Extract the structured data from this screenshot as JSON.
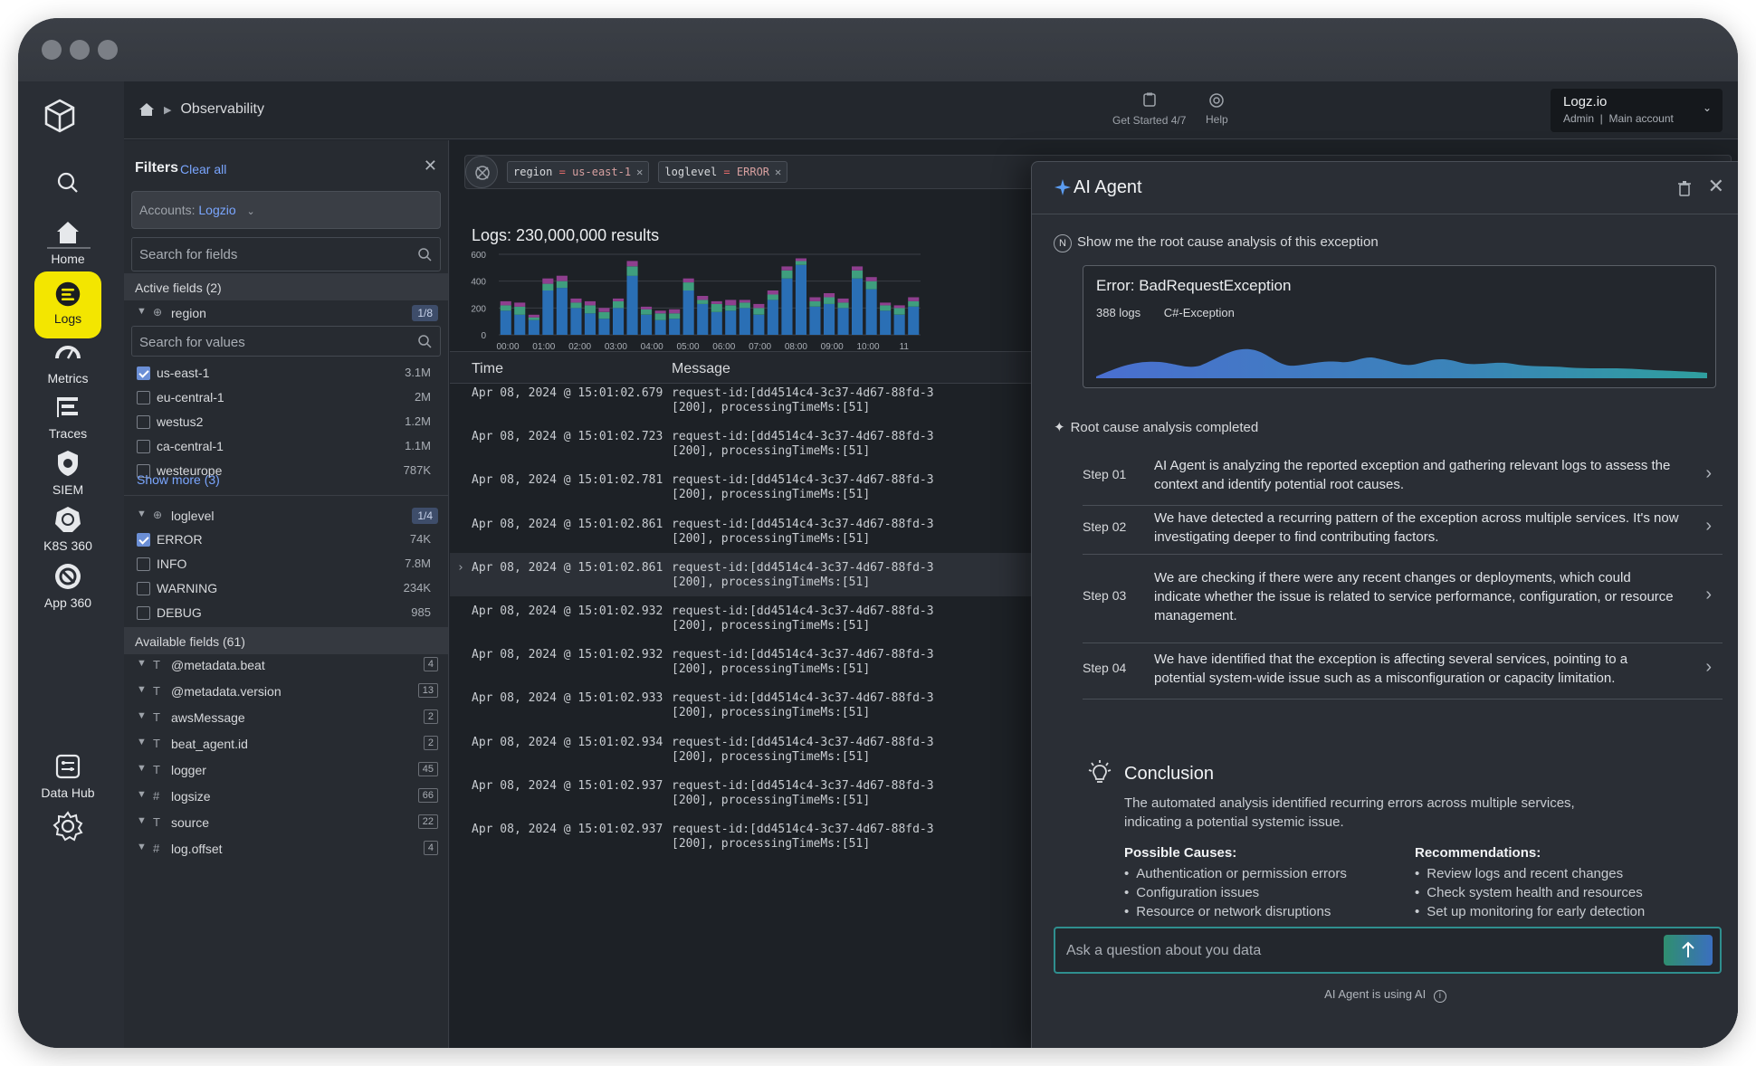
{
  "window": {
    "controls": [
      "close",
      "minimize",
      "maximize"
    ]
  },
  "rail": {
    "items": [
      {
        "label": "",
        "icon": "search-icon"
      },
      {
        "label": "Home",
        "icon": "home-icon"
      },
      {
        "label": "Logs",
        "icon": "logs-icon",
        "active": true
      },
      {
        "label": "Metrics",
        "icon": "gauge-icon"
      },
      {
        "label": "Traces",
        "icon": "traces-icon"
      },
      {
        "label": "SIEM",
        "icon": "shield-icon"
      },
      {
        "label": "K8S 360",
        "icon": "kubernetes-icon"
      },
      {
        "label": "App 360",
        "icon": "app-icon"
      },
      {
        "label": "Data Hub",
        "icon": "data-hub-icon"
      }
    ],
    "accent_color": "#f3e600"
  },
  "header": {
    "breadcrumb": "Observability",
    "get_started": "Get Started 4/7",
    "help": "Help",
    "account_name": "Logz.io",
    "account_role": "Admin",
    "account_sub": "Main account"
  },
  "filters": {
    "title": "Filters",
    "clear_all": "Clear all",
    "accounts_label": "Accounts:",
    "accounts_value": "Logzio",
    "search_fields_placeholder": "Search for fields",
    "active_fields": "Active fields (2)",
    "region": {
      "label": "region",
      "badge": "1/8",
      "search_placeholder": "Search for values",
      "values": [
        {
          "label": "us-east-1",
          "count": "3.1M",
          "checked": true
        },
        {
          "label": "eu-central-1",
          "count": "2M",
          "checked": false
        },
        {
          "label": "westus2",
          "count": "1.2M",
          "checked": false
        },
        {
          "label": "ca-central-1",
          "count": "1.1M",
          "checked": false
        },
        {
          "label": "westeurope",
          "count": "787K",
          "checked": false
        }
      ],
      "show_more": "Show more (3)"
    },
    "loglevel": {
      "label": "loglevel",
      "badge": "1/4",
      "values": [
        {
          "label": "ERROR",
          "count": "74K",
          "checked": true
        },
        {
          "label": "INFO",
          "count": "7.8M",
          "checked": false
        },
        {
          "label": "WARNING",
          "count": "234K",
          "checked": false
        },
        {
          "label": "DEBUG",
          "count": "985",
          "checked": false
        }
      ]
    },
    "available_fields": "Available fields (61)",
    "available": [
      {
        "type": "T",
        "label": "@metadata.beat",
        "count": "4"
      },
      {
        "type": "T",
        "label": "@metadata.version",
        "count": "13"
      },
      {
        "type": "T",
        "label": "awsMessage",
        "count": "2"
      },
      {
        "type": "T",
        "label": "beat_agent.id",
        "count": "2"
      },
      {
        "type": "T",
        "label": "logger",
        "count": "45"
      },
      {
        "type": "#",
        "label": "logsize",
        "count": "66"
      },
      {
        "type": "T",
        "label": "source",
        "count": "22"
      },
      {
        "type": "#",
        "label": "log.offset",
        "count": "4"
      }
    ]
  },
  "query": {
    "chips": [
      {
        "field": "region",
        "op": "=",
        "value": "us-east-1"
      },
      {
        "field": "loglevel",
        "op": "=",
        "value": "ERROR"
      }
    ]
  },
  "logs": {
    "results_title": "Logs: 230,000,000 results",
    "columns": [
      "Time",
      "Message"
    ],
    "rows": [
      {
        "time": "Apr 08, 2024 @ 15:01:02.679",
        "msg1": "request-id:[dd4514c4-3c37-4d67-88fd-3",
        "msg2": "[200], processingTimeMs:[51]"
      },
      {
        "time": "Apr 08, 2024 @ 15:01:02.723",
        "msg1": "request-id:[dd4514c4-3c37-4d67-88fd-3",
        "msg2": "[200], processingTimeMs:[51]"
      },
      {
        "time": "Apr 08, 2024 @ 15:01:02.781",
        "msg1": "request-id:[dd4514c4-3c37-4d67-88fd-3",
        "msg2": "[200], processingTimeMs:[51]"
      },
      {
        "time": "Apr 08, 2024 @ 15:01:02.861",
        "msg1": "request-id:[dd4514c4-3c37-4d67-88fd-3",
        "msg2": "[200], processingTimeMs:[51]"
      },
      {
        "time": "Apr 08, 2024 @ 15:01:02.861",
        "msg1": "request-id:[dd4514c4-3c37-4d67-88fd-3",
        "msg2": "[200], processingTimeMs:[51]",
        "selected": true
      },
      {
        "time": "Apr 08, 2024 @ 15:01:02.932",
        "msg1": "request-id:[dd4514c4-3c37-4d67-88fd-3",
        "msg2": "[200], processingTimeMs:[51]"
      },
      {
        "time": "Apr 08, 2024 @ 15:01:02.932",
        "msg1": "request-id:[dd4514c4-3c37-4d67-88fd-3",
        "msg2": "[200], processingTimeMs:[51]"
      },
      {
        "time": "Apr 08, 2024 @ 15:01:02.933",
        "msg1": "request-id:[dd4514c4-3c37-4d67-88fd-3",
        "msg2": "[200], processingTimeMs:[51]"
      },
      {
        "time": "Apr 08, 2024 @ 15:01:02.934",
        "msg1": "request-id:[dd4514c4-3c37-4d67-88fd-3",
        "msg2": "[200], processingTimeMs:[51]"
      },
      {
        "time": "Apr 08, 2024 @ 15:01:02.937",
        "msg1": "request-id:[dd4514c4-3c37-4d67-88fd-3",
        "msg2": "[200], processingTimeMs:[51]"
      },
      {
        "time": "Apr 08, 2024 @ 15:01:02.937",
        "msg1": "request-id:[dd4514c4-3c37-4d67-88fd-3",
        "msg2": "[200], processingTimeMs:[51]"
      }
    ]
  },
  "chart_data": {
    "type": "bar",
    "title": "",
    "xlabel": "",
    "ylabel": "",
    "ylim": [
      0,
      600
    ],
    "yticks": [
      0,
      200,
      400,
      600
    ],
    "x_tick_labels": [
      "00:00",
      "01:00",
      "02:00",
      "03:00",
      "04:00",
      "05:00",
      "06:00",
      "07:00",
      "08:00",
      "09:00",
      "10:00",
      "11"
    ],
    "series": [
      {
        "color": "#2a6fb5",
        "values": [
          180,
          150,
          110,
          330,
          350,
          200,
          160,
          120,
          200,
          440,
          150,
          110,
          120,
          330,
          230,
          170,
          180,
          200,
          150,
          260,
          420,
          520,
          210,
          230,
          200,
          420,
          340,
          180,
          150,
          210
        ]
      },
      {
        "color": "#3f9e7e",
        "values": [
          40,
          60,
          20,
          50,
          50,
          40,
          60,
          50,
          50,
          70,
          40,
          50,
          40,
          60,
          30,
          60,
          40,
          40,
          50,
          40,
          60,
          30,
          40,
          50,
          40,
          60,
          60,
          40,
          50,
          40
        ]
      },
      {
        "color": "#8e3f8e",
        "values": [
          30,
          30,
          20,
          40,
          40,
          30,
          30,
          30,
          20,
          40,
          20,
          20,
          30,
          30,
          30,
          20,
          40,
          20,
          30,
          30,
          30,
          20,
          30,
          30,
          30,
          30,
          30,
          20,
          20,
          30
        ]
      }
    ]
  },
  "agent": {
    "title": "AI Agent",
    "user_initial": "N",
    "question": "Show me the root cause analysis of this exception",
    "error_title": "Error: BadRequestException",
    "error_logs": "388 logs",
    "error_type": "C#-Exception",
    "rc_done": "Root cause analysis completed",
    "steps": [
      {
        "label": "Step 01",
        "text": "AI Agent is analyzing the reported exception and gathering relevant logs to assess the context and identify potential root causes."
      },
      {
        "label": "Step 02",
        "text": "We have detected a recurring pattern of the exception across multiple services. It's now investigating deeper to find contributing factors."
      },
      {
        "label": "Step 03",
        "text": "We are checking if there were any recent changes or deployments, which could indicate whether the issue is related to service performance, configuration, or resource management."
      },
      {
        "label": "Step 04",
        "text": "We have identified that the exception is affecting several services, pointing to a potential system-wide issue such as a misconfiguration or capacity limitation."
      }
    ],
    "conclusion_title": "Conclusion",
    "conclusion_text": "The automated analysis identified recurring errors across multiple services, indicating a potential systemic issue.",
    "causes_title": "Possible Causes:",
    "causes": [
      "Authentication or permission errors",
      "Configuration issues",
      "Resource or network disruptions"
    ],
    "recs_title": "Recommendations:",
    "recs": [
      "Review logs and recent changes",
      "Check system health and resources",
      "Set up monitoring for early detection"
    ],
    "ask_placeholder": "Ask a question about you data",
    "ai_note": "AI Agent is using AI"
  }
}
